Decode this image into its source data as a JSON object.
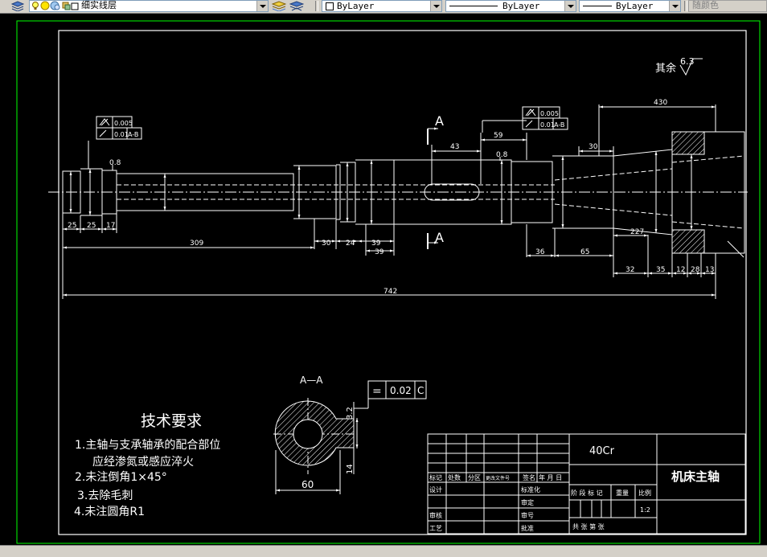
{
  "toolbar": {
    "layer_name": "细实线层",
    "color_value": "ByLayer",
    "linetype_value": "ByLayer",
    "lineweight_value": "ByLayer",
    "plotstyle_value": "随颜色"
  },
  "drawing": {
    "roughness_label": "其余",
    "roughness_value": "6.3",
    "section_mark": "A",
    "section_title": "A—A",
    "dims": {
      "total": "742",
      "d309": "309",
      "d430": "430",
      "d43": "43",
      "d59": "59",
      "d30": "30",
      "d36": "36",
      "d65": "65",
      "d227": "227",
      "d32": "32",
      "d35": "35",
      "d12": "12",
      "d28": "28",
      "d13": "13",
      "d24": "24",
      "d39": "39",
      "d39b": "39",
      "d25": "25",
      "d25b": "25",
      "d17": "17",
      "key_width": "14",
      "key_depth": "3.2",
      "shaft_dia": "60",
      "chamfer": "0.8"
    },
    "gtol_left_1": "0.005",
    "gtol_left_2": "0.01",
    "gtol_left_ref": "A-B",
    "gtol_mid_1": "0.005",
    "gtol_mid_2": "0.01",
    "gtol_mid_ref": "A-B",
    "section_gtol_value": "0.02",
    "section_gtol_ref": "C",
    "section_gtol_symbol": "="
  },
  "notes": {
    "title": "技术要求",
    "items": [
      "1.主轴与支承轴承的配合部位",
      "应经渗氮或感应淬火",
      "2.未注倒角1×45°",
      "3.去除毛刺",
      "4.未注圆角R1"
    ]
  },
  "title_block": {
    "material": "40Cr",
    "part_name": "机床主轴",
    "scale": "1:2",
    "headers": [
      "标记",
      "处数",
      "分区",
      "更改文件号",
      "签名",
      "年 月 日"
    ],
    "rows": [
      "设计",
      "审核",
      "工艺"
    ],
    "mid_labels": [
      "标准化",
      "审定",
      "审号",
      "批准"
    ],
    "stage_label": "阶 段 标 记",
    "weight_label": "重量",
    "ratio_label": "比例",
    "sheet_label": "共    张  第    张"
  },
  "colors": {
    "line": "#ffffff",
    "dim": "#ffffff",
    "frame_outer": "#00ff00",
    "toolbar_bg": "#d4d0c8"
  }
}
